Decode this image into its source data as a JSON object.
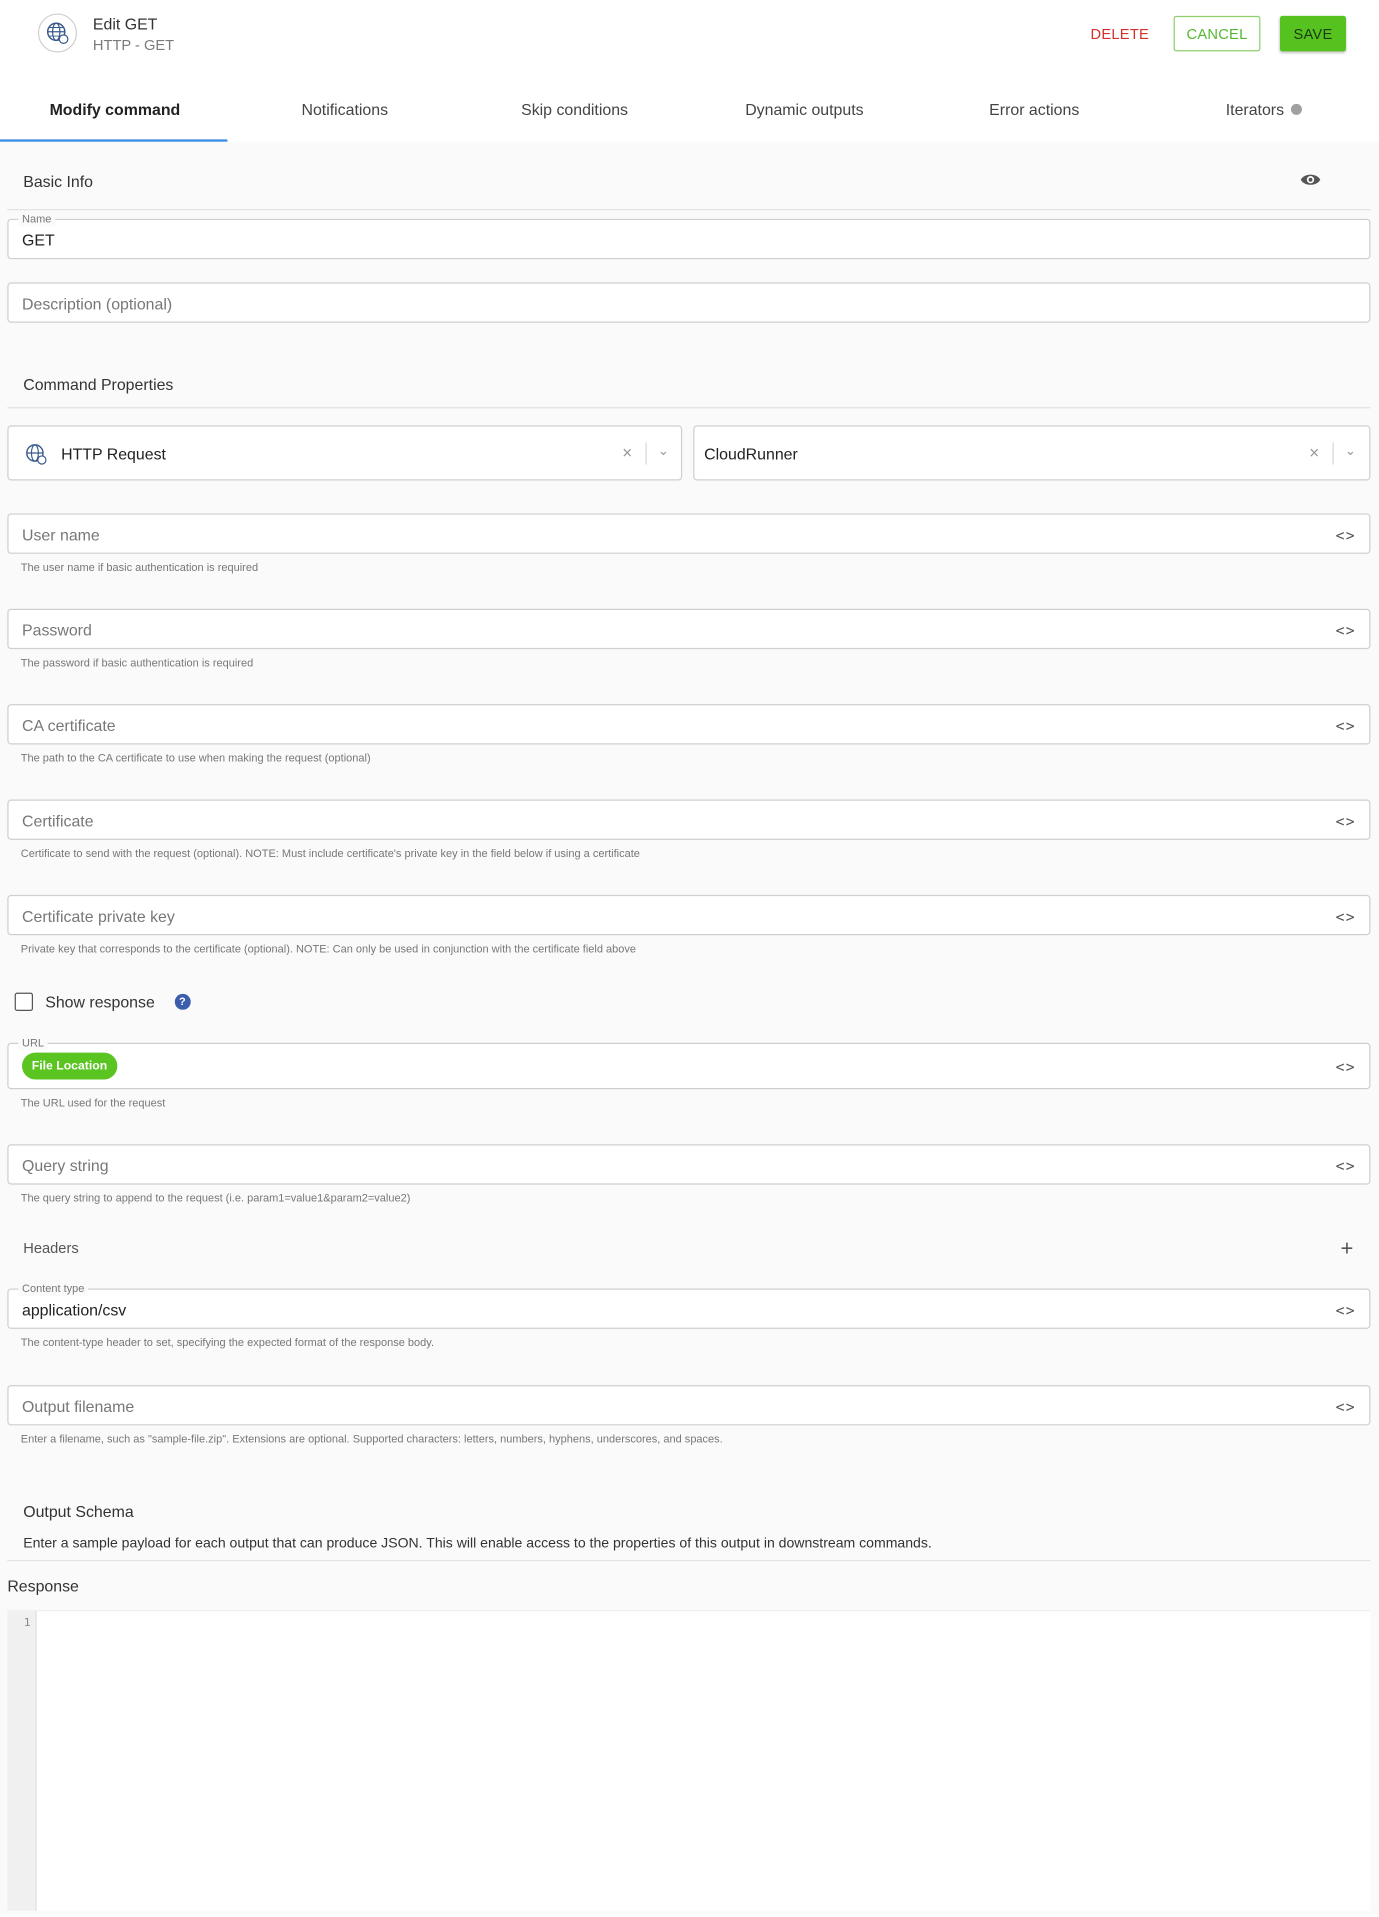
{
  "header": {
    "title": "Edit GET",
    "subtitle": "HTTP - GET",
    "delete_label": "DELETE",
    "cancel_label": "CANCEL",
    "save_label": "SAVE",
    "icon": "globe-icon"
  },
  "tabs": [
    {
      "label": "Modify command",
      "active": true
    },
    {
      "label": "Notifications",
      "active": false
    },
    {
      "label": "Skip conditions",
      "active": false
    },
    {
      "label": "Dynamic outputs",
      "active": false
    },
    {
      "label": "Error actions",
      "active": false
    },
    {
      "label": "Iterators",
      "active": false
    }
  ],
  "basic_info": {
    "heading": "Basic Info",
    "name_label": "Name",
    "name_value": "GET",
    "description_placeholder": "Description (optional)"
  },
  "command_properties": {
    "heading": "Command Properties",
    "command_type": "HTTP Request",
    "runner": "CloudRunner",
    "clear_symbol": "×"
  },
  "fields": {
    "username": {
      "placeholder": "User name",
      "helper": "The user name if basic authentication is required"
    },
    "password": {
      "placeholder": "Password",
      "helper": "The password if basic authentication is required"
    },
    "ca_certificate": {
      "placeholder": "CA certificate",
      "helper": "The path to the CA certificate to use when making the request (optional)"
    },
    "certificate": {
      "placeholder": "Certificate",
      "helper": "Certificate to send with the request (optional). NOTE: Must include certificate's private key in the field below if using a certificate"
    },
    "certificate_private_key": {
      "placeholder": "Certificate private key",
      "helper": "Private key that corresponds to the certificate (optional). NOTE: Can only be used in conjunction with the certificate field above"
    },
    "url": {
      "label": "URL",
      "chip": "File Location",
      "helper": "The URL used for the request"
    },
    "query_string": {
      "placeholder": "Query string",
      "helper": "The query string to append to the request (i.e. param1=value1&param2=value2)"
    },
    "content_type": {
      "label": "Content type",
      "value": "application/csv",
      "helper": "The content-type header to set, specifying the expected format of the response body."
    },
    "output_filename": {
      "placeholder": "Output filename",
      "helper": "Enter a filename, such as \"sample-file.zip\". Extensions are optional. Supported characters: letters, numbers, hyphens, underscores, and spaces."
    }
  },
  "show_response": {
    "label": "Show response",
    "checked": false
  },
  "headers": {
    "heading": "Headers"
  },
  "output_schema": {
    "heading": "Output Schema",
    "description": "Enter a sample payload for each output that can produce JSON. This will enable access to the properties of this output in downstream commands.",
    "response_label": "Response",
    "line_number": "1"
  },
  "colors": {
    "accent_tab": "#3a8ee6",
    "save_bg": "#55c21f",
    "delete_text": "#d32f2f",
    "chip_bg": "#5ac420"
  }
}
